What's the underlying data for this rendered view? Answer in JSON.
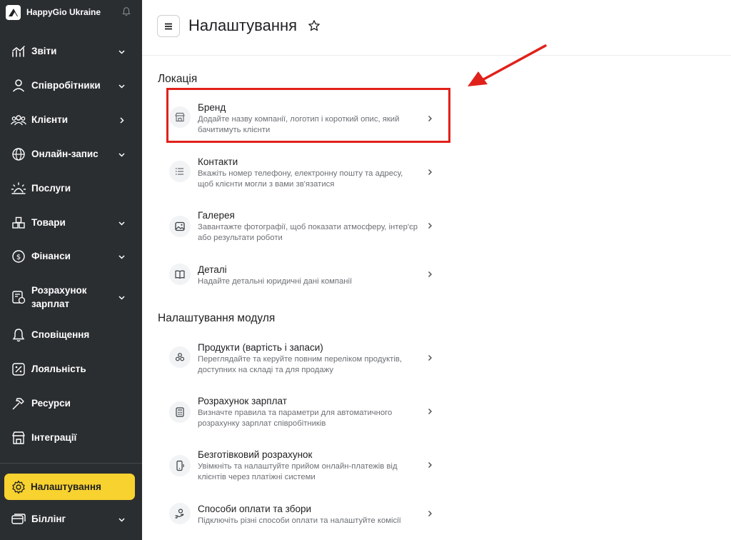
{
  "sidebar": {
    "brand_name": "HappyGio Ukraine",
    "items": [
      {
        "label": "Звіти",
        "icon": "chart-icon"
      },
      {
        "label": "Співробітники",
        "icon": "person-icon"
      },
      {
        "label": "Клієнти",
        "icon": "people-icon"
      },
      {
        "label": "Онлайн-запис",
        "icon": "globe-icon"
      },
      {
        "label": "Послуги",
        "icon": "sunrise-icon"
      },
      {
        "label": "Товари",
        "icon": "boxes-icon"
      },
      {
        "label": "Фінанси",
        "icon": "coin-icon"
      },
      {
        "label": "Розрахунок зарплат",
        "icon": "payroll-icon"
      },
      {
        "label": "Сповіщення",
        "icon": "bell-icon"
      },
      {
        "label": "Лояльність",
        "icon": "percent-icon"
      },
      {
        "label": "Ресурси",
        "icon": "hammer-icon"
      },
      {
        "label": "Інтеграції",
        "icon": "store-icon"
      },
      {
        "label": "Налаштування",
        "icon": "gear-icon"
      },
      {
        "label": "Біллінг",
        "icon": "cards-icon"
      }
    ],
    "active_color": "#f8d22f",
    "background": "#2b2e31"
  },
  "header": {
    "title": "Налаштування"
  },
  "sections": {
    "location": {
      "title": "Локація",
      "rows": [
        {
          "title": "Бренд",
          "desc": "Додайте назву компанії, логотип і короткий опис, який бачитимуть клієнти",
          "icon": "storefront-icon"
        },
        {
          "title": "Контакти",
          "desc": "Вкажіть номер телефону, електронну пошту та адресу, щоб клієнти могли з вами зв'язатися",
          "icon": "list-icon"
        },
        {
          "title": "Галерея",
          "desc": "Завантажте фотографії, щоб показати атмосферу, інтер'єр або результати роботи",
          "icon": "image-icon"
        },
        {
          "title": "Деталі",
          "desc": "Надайте детальні юридичні дані компанії",
          "icon": "book-icon"
        }
      ]
    },
    "modules": {
      "title": "Налаштування модуля",
      "rows": [
        {
          "title": "Продукти (вартість і запаси)",
          "desc": "Переглядайте та керуйте повним переліком продуктів, доступних на складі та для продажу",
          "icon": "cubes-icon"
        },
        {
          "title": "Розрахунок зарплат",
          "desc": "Визначте правила та параметри для автоматичного розрахунку зарплат співробітників",
          "icon": "calculator-icon"
        },
        {
          "title": "Безготівковий розрахунок",
          "desc": "Увімкніть та налаштуйте прийом онлайн-платежів від клієнтів через платіжні системи",
          "icon": "phone-pay-icon"
        },
        {
          "title": "Способи оплати та збори",
          "desc": "Підключіть різні способи оплати та налаштуйте комісії",
          "icon": "hand-coin-icon"
        }
      ]
    }
  },
  "annotation_color": "#e0211a"
}
